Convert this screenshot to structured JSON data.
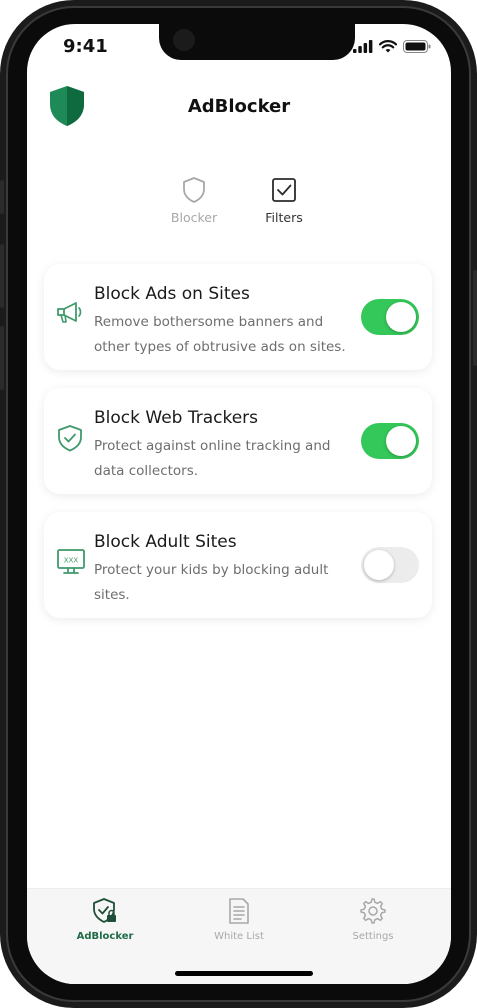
{
  "status_bar": {
    "time": "9:41"
  },
  "header": {
    "title": "AdBlocker",
    "logo_icon": "shield-logo-icon"
  },
  "segments": [
    {
      "label": "Blocker",
      "icon": "shield-outline-icon",
      "active": false
    },
    {
      "label": "Filters",
      "icon": "checkbox-icon",
      "active": true
    }
  ],
  "cards": [
    {
      "title": "Block Ads on Sites",
      "desc_line1": "Remove bothersome banners and",
      "desc_line2": "other types of obtrusive ads on sites.",
      "icon": "megaphone-icon",
      "enabled": true
    },
    {
      "title": "Block Web Trackers",
      "desc_line1": "Protect against online tracking and",
      "desc_line2": "data collectors.",
      "icon": "shield-check-icon",
      "enabled": true
    },
    {
      "title": "Block Adult Sites",
      "desc_line1": "Protect your kids by blocking adult",
      "desc_line2": "sites.",
      "icon_text": "XXX",
      "icon": "monitor-xxx-icon",
      "enabled": false
    }
  ],
  "tabbar": [
    {
      "label": "AdBlocker",
      "icon": "shield-lock-icon",
      "active": true
    },
    {
      "label": "White List",
      "icon": "document-list-icon",
      "active": false
    },
    {
      "label": "Settings",
      "icon": "gear-icon",
      "active": false
    }
  ],
  "colors": {
    "accent": "#1f8a54",
    "toggle_on": "#34c759",
    "toggle_off": "#ececec",
    "icon_green": "#3f9a6b",
    "inactive": "#a8a8a8"
  }
}
